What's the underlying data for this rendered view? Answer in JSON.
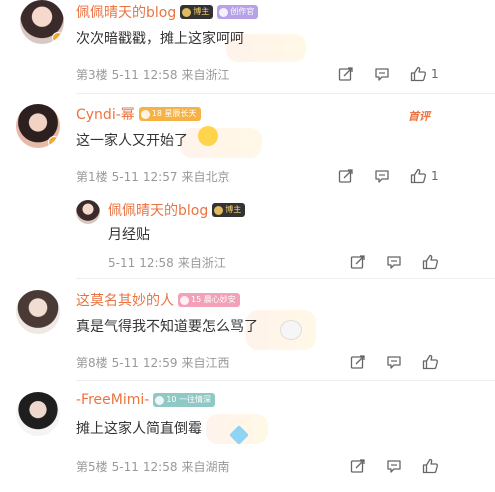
{
  "colors": {
    "username": "#eb7340",
    "meta": "#999999",
    "accent": "#f7a52b"
  },
  "comments": [
    {
      "name": "佩佩晴天的blog",
      "tags": [
        "博主",
        "创作官"
      ],
      "text": "次次暗戳戳，摊上这家呵呵",
      "floor": "第3楼",
      "date": "5-11",
      "time": "12:58",
      "location": "来自浙江",
      "like_count": "1"
    },
    {
      "name": "Cyndi-幂",
      "tags": [
        "18 星辰长天"
      ],
      "badge_right": "首评",
      "text": "这一家人又开始了",
      "floor": "第1楼",
      "date": "5-11",
      "time": "12:57",
      "location": "来自北京",
      "like_count": "1"
    },
    {
      "name": "这莫名其妙的人",
      "tags": [
        "15 晨心妙安"
      ],
      "text": "真是气得我不知道要怎么骂了",
      "floor": "第8楼",
      "date": "5-11",
      "time": "12:59",
      "location": "来自江西",
      "like_count": ""
    },
    {
      "name": "-FreeMimi-",
      "tags": [
        "10 一往情深"
      ],
      "text": "摊上这家人简直倒霉",
      "floor": "第5楼",
      "date": "5-11",
      "time": "12:58",
      "location": "来自湖南",
      "like_count": ""
    }
  ],
  "reply": {
    "name": "佩佩晴天的blog",
    "tags": [
      "博主"
    ],
    "text": "月经贴",
    "date": "5-11",
    "time": "12:58",
    "location": "来自浙江"
  },
  "icons": {
    "share": "share-icon",
    "comment": "comment-icon",
    "like": "like-icon"
  }
}
